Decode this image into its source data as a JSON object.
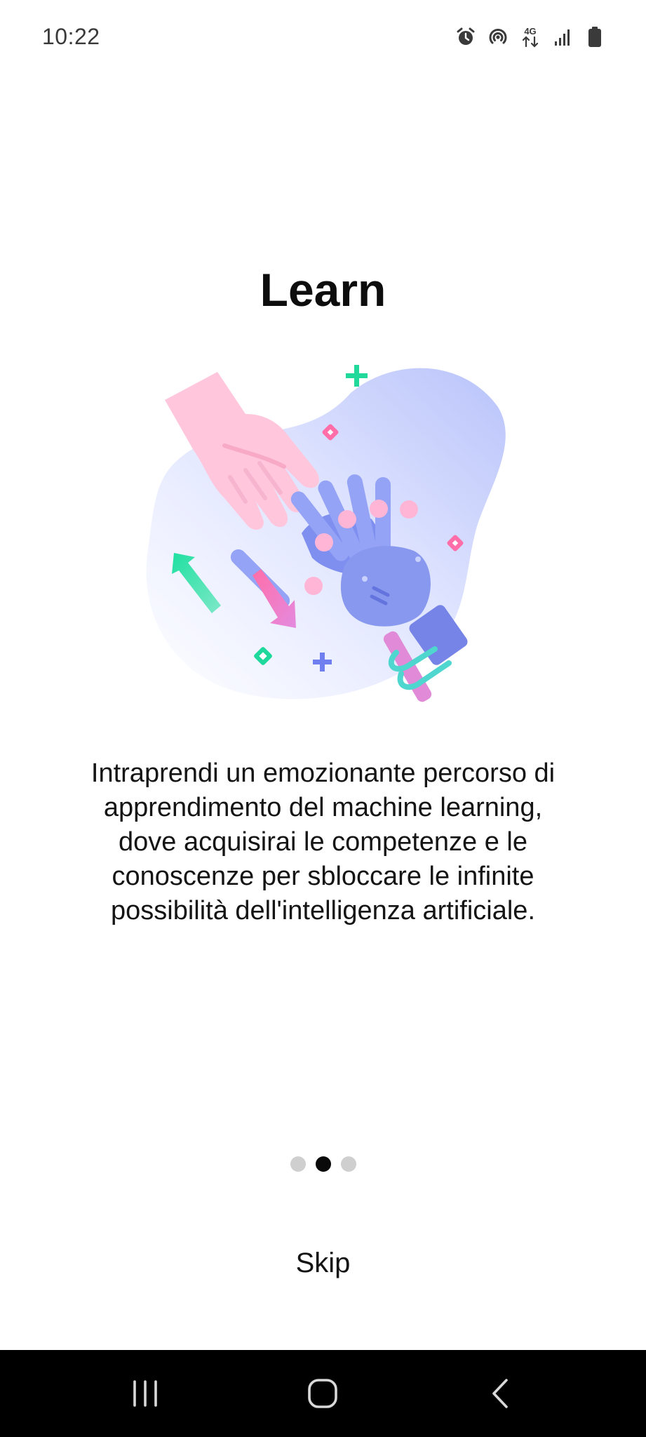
{
  "status_bar": {
    "time": "10:22",
    "icons": [
      "alarm-icon",
      "hotspot-icon",
      "4g-data-icon",
      "signal-icon",
      "battery-icon"
    ],
    "network_label": "4G"
  },
  "onboarding": {
    "title": "Learn",
    "illustration": "human-and-robot-hands-illustration",
    "description": "Intraprendi un emozionante percorso di apprendimento del machine learning, dove acquisirai le competenze e le conoscenze per sbloccare le infinite possibilità dell'intelligenza artificiale.",
    "pager": {
      "total": 3,
      "current": 2
    },
    "skip_label": "Skip"
  },
  "nav_bar": {
    "buttons": [
      "recent-apps-icon",
      "home-icon",
      "back-icon"
    ]
  },
  "colors": {
    "title": "#0d0d0d",
    "dot_active": "#0a0a0a",
    "dot_inactive": "#cfcfcf",
    "nav_bg": "#000000",
    "blob": "#c4ccfa",
    "human_hand": "#ffc6dc",
    "robot_hand": "#8b9cf0"
  }
}
